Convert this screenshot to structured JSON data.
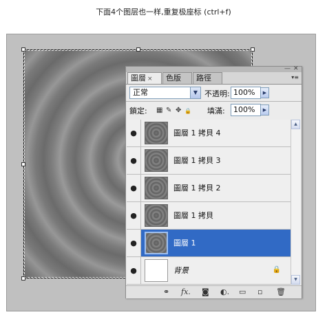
{
  "caption": "下面4个图层也一样,重复极座标 (ctrl+f)",
  "panel": {
    "tabs": [
      {
        "label": "圖層",
        "close": "×"
      },
      {
        "label": "色版"
      },
      {
        "label": "路徑"
      }
    ],
    "window_buttons": {
      "minimize": "—",
      "close": "✕"
    },
    "menu_icon": "▾≡",
    "blend_mode": "正常",
    "opacity_label": "不透明:",
    "opacity_value": "100%",
    "lock_label": "鎖定:",
    "fill_label": "填滿:",
    "fill_value": "100%",
    "layers": [
      {
        "name": "圖層 1 拷貝 4",
        "visible": true,
        "selected": false
      },
      {
        "name": "圖層 1 拷貝 3",
        "visible": true,
        "selected": false
      },
      {
        "name": "圖層 1 拷貝 2",
        "visible": true,
        "selected": false
      },
      {
        "name": "圖層 1 拷貝",
        "visible": true,
        "selected": false
      },
      {
        "name": "圖層 1",
        "visible": true,
        "selected": true
      },
      {
        "name": "背景",
        "visible": true,
        "selected": false,
        "locked": true
      }
    ],
    "icons": {
      "eye": "●",
      "lock_transparent": "▦",
      "lock_paint": "✎",
      "lock_move": "✥",
      "lock_all": "🔒",
      "bottom": [
        "link-icon",
        "fx-icon",
        "mask-icon",
        "adjustment-icon",
        "group-icon",
        "new-layer-icon",
        "trash-icon"
      ]
    },
    "selected_color": "#316ac5"
  }
}
